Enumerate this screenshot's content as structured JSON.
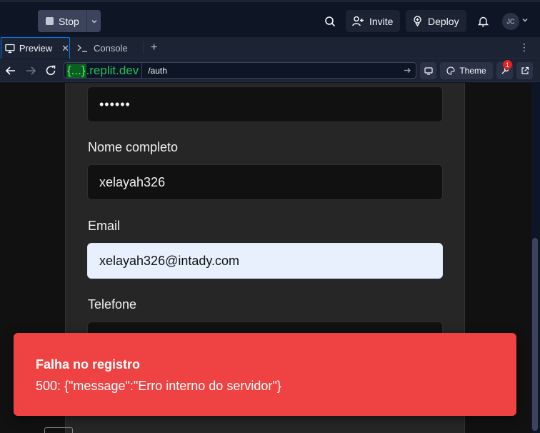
{
  "topbar": {
    "stop_label": "Stop",
    "invite_label": "Invite",
    "deploy_label": "Deploy",
    "avatar_initials": "JC"
  },
  "tabs": [
    {
      "label": "Preview",
      "active": true
    },
    {
      "label": "Console",
      "active": false
    }
  ],
  "address": {
    "domain_brace": "{...}",
    "domain_suffix": ".replit.dev",
    "path": "/auth"
  },
  "toolbar": {
    "theme_label": "Theme",
    "notification_count": "1"
  },
  "form": {
    "password_value": "••••••",
    "fullname_label": "Nome completo",
    "fullname_value": "xelayah326",
    "email_label": "Email",
    "email_value": "xelayah326@intady.com",
    "phone_label": "Telefone",
    "phone_value": ""
  },
  "toast": {
    "title": "Falha no registro",
    "message": "500: {\"message\":\"Erro interno do servidor\"}"
  },
  "colors": {
    "accent": "#0079f2",
    "toast_bg": "#ef4343",
    "domain_green": "#26c15b"
  }
}
